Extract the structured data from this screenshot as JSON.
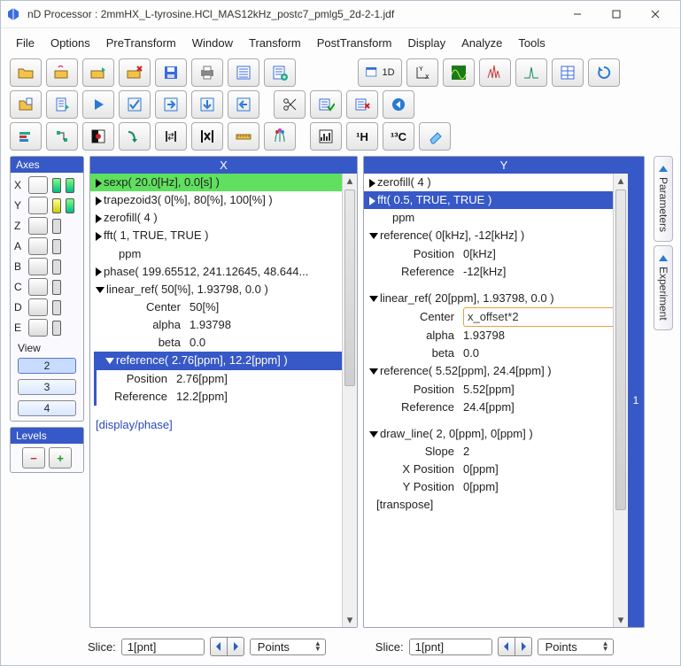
{
  "window": {
    "title": "nD Processor : 2mmHX_L-tyrosine.HCl_MAS12kHz_postc7_pmlg5_2d-2-1.jdf"
  },
  "menu": {
    "file": "File",
    "options": "Options",
    "pretransform": "PreTransform",
    "windowm": "Window",
    "transform": "Transform",
    "posttransform": "PostTransform",
    "display": "Display",
    "analyze": "Analyze",
    "tools": "Tools"
  },
  "toolbar": {
    "row1_icons": [
      "folder-open-icon",
      "hand-folder-icon",
      "folder-export-icon",
      "folder-cancel-icon",
      "save-icon",
      "print-icon",
      "list-icon",
      "list-add-icon"
    ],
    "row1_right_icons": [
      "window-1d-icon",
      "axis-xy-icon",
      "spectrum-green-icon",
      "peak-multi-icon",
      "peak-single-icon",
      "table-icon",
      "refresh-icon"
    ],
    "row1_1d_label": "1D",
    "row2_icons": [
      "doc-rows-icon",
      "doc-rows-alt-icon",
      "play-icon",
      "check-icon",
      "arrow-right-box-icon",
      "arrow-down-box-icon",
      "arrow-left-box-icon",
      "scissors-icon",
      "rows-okay-icon",
      "rows-cancel-icon",
      "circle-left-icon"
    ],
    "row3_icons": [
      "align-left-color-icon",
      "tree-icon",
      "contrast-icon",
      "curve-down-icon",
      "bracket-swap-icon",
      "abs-x-icon",
      "ruler-icon",
      "flowers-icon",
      "histogram-icon"
    ],
    "row3_1h": "¹H",
    "row3_13c": "¹³C",
    "row3_eraser": "eraser-icon"
  },
  "side_tabs": {
    "parameters": "Parameters",
    "experiment": "Experiment"
  },
  "axes": {
    "title": "Axes",
    "rows": [
      {
        "l": "X"
      },
      {
        "l": "Y"
      },
      {
        "l": "Z"
      },
      {
        "l": "A"
      },
      {
        "l": "B"
      },
      {
        "l": "C"
      },
      {
        "l": "D"
      },
      {
        "l": "E"
      }
    ],
    "view_label": "View",
    "view_buttons": [
      "2",
      "3",
      "4"
    ]
  },
  "levels": {
    "title": "Levels"
  },
  "colX": {
    "header": "X",
    "items": {
      "sexp": "sexp( 20.0[Hz], 0.0[s] )",
      "trap": "trapezoid3( 0[%], 80[%], 100[%] )",
      "zerofill": "zerofill( 4 )",
      "fft": "fft( 1, TRUE, TRUE )",
      "ppm": "ppm",
      "phase": "phase( 199.65512, 241.12645, 48.644...",
      "linref": "linear_ref( 50[%], 1.93798, 0.0 )",
      "center_k": "Center",
      "center_v": "50[%]",
      "alpha_k": "alpha",
      "alpha_v": "1.93798",
      "beta_k": "beta",
      "beta_v": "0.0",
      "reference": "reference( 2.76[ppm], 12.2[ppm] )",
      "pos_k": "Position",
      "pos_v": "2.76[ppm]",
      "ref_k": "Reference",
      "ref_v": "12.2[ppm]",
      "display_phase": "[display/phase]"
    }
  },
  "colY": {
    "header": "Y",
    "rail": "1",
    "items": {
      "zerofill": "zerofill( 4 )",
      "fft": "fft( 0.5, TRUE, TRUE )",
      "ppm": "ppm",
      "reference1": "reference( 0[kHz], -12[kHz] )",
      "pos1_k": "Position",
      "pos1_v": "0[kHz]",
      "ref1_k": "Reference",
      "ref1_v": "-12[kHz]",
      "linref": "linear_ref( 20[ppm], 1.93798, 0.0 )",
      "center_k": "Center",
      "center_v": "x_offset*2",
      "alpha_k": "alpha",
      "alpha_v": "1.93798",
      "beta_k": "beta",
      "beta_v": "0.0",
      "reference2": "reference( 5.52[ppm], 24.4[ppm] )",
      "pos2_k": "Position",
      "pos2_v": "5.52[ppm]",
      "ref2_k": "Reference",
      "ref2_v": "24.4[ppm]",
      "drawline": "draw_line( 2, 0[ppm], 0[ppm] )",
      "slope_k": "Slope",
      "slope_v": "2",
      "xp_k": "X Position",
      "xp_v": "0[ppm]",
      "yp_k": "Y Position",
      "yp_v": "0[ppm]",
      "transpose": "[transpose]"
    }
  },
  "bottom": {
    "slice_label": "Slice:",
    "slice_value": "1[pnt]",
    "points_label": "Points"
  }
}
